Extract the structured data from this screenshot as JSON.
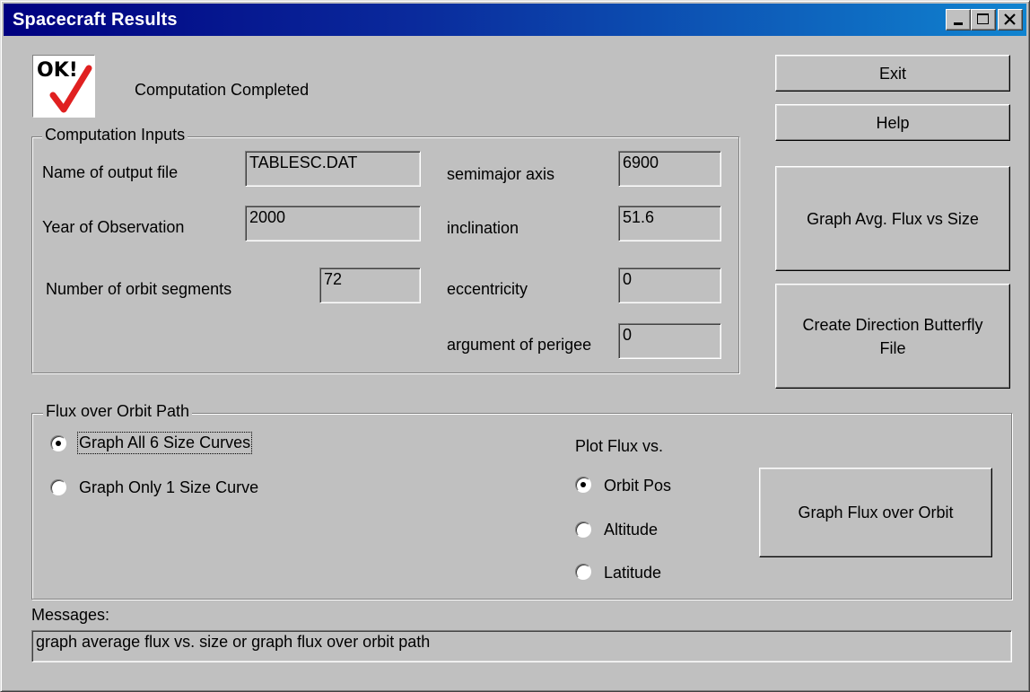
{
  "window": {
    "title": "Spacecraft Results",
    "titlebar_gradient_start": "#000080",
    "titlebar_gradient_end": "#1084d0",
    "controls": [
      "minimize-icon",
      "maximize-icon",
      "close-icon"
    ]
  },
  "status": {
    "icon_text": "OK!",
    "icon_name": "ok-check-icon",
    "check_color": "#e02020",
    "message": "Computation Completed"
  },
  "inputs": {
    "group_title": "Computation Inputs",
    "output_file_label": "Name of output file",
    "output_file_value": "TABLESC.DAT",
    "year_label": "Year of Observation",
    "year_value": "2000",
    "segments_label": "Number of orbit segments",
    "segments_value": "72",
    "semimajor_label": "semimajor axis",
    "semimajor_value": "6900",
    "inclination_label": "inclination",
    "inclination_value": "51.6",
    "eccentricity_label": "eccentricity",
    "eccentricity_value": "0",
    "perigee_label": "argument of perigee",
    "perigee_value": "0"
  },
  "buttons": {
    "exit": "Exit",
    "help": "Help",
    "graph_avg": "Graph Avg. Flux vs Size",
    "butterfly_line1": "Create Direction Butterfly",
    "butterfly_line2": "File",
    "graph_flux": "Graph Flux over Orbit"
  },
  "flux": {
    "group_title": "Flux over Orbit Path",
    "curve_options": [
      {
        "label": "Graph All 6 Size Curves",
        "selected": true
      },
      {
        "label": "Graph Only 1 Size Curve",
        "selected": false
      }
    ],
    "plot_title": "Plot Flux vs.",
    "plot_options": [
      {
        "label": "Orbit Pos",
        "selected": true
      },
      {
        "label": "Altitude",
        "selected": false
      },
      {
        "label": "Latitude",
        "selected": false
      }
    ]
  },
  "messages": {
    "label": "Messages:",
    "text": "graph average flux vs. size or graph flux over orbit path"
  }
}
